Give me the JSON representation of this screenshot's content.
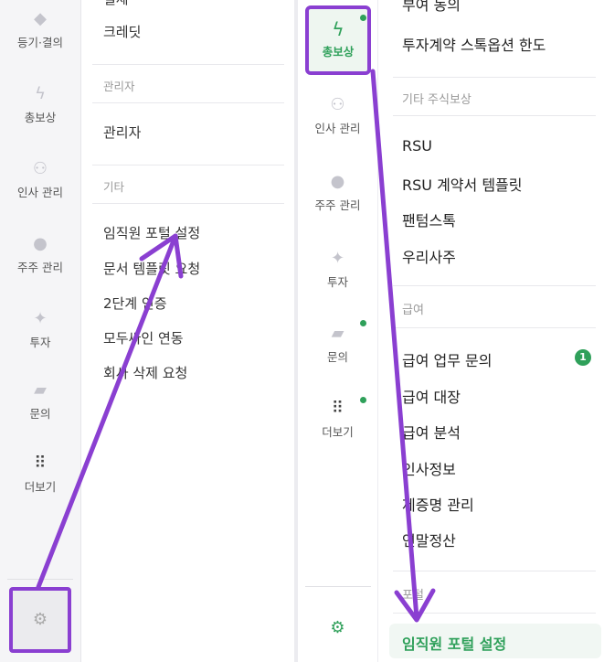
{
  "left_rail": {
    "items": [
      {
        "label": "등기·결의",
        "icon": "layers-icon"
      },
      {
        "label": "총보상",
        "icon": "bolt-icon"
      },
      {
        "label": "인사 관리",
        "icon": "people-icon"
      },
      {
        "label": "주주 관리",
        "icon": "pie-icon"
      },
      {
        "label": "투자",
        "icon": "coin-icon"
      },
      {
        "label": "문의",
        "icon": "chat-icon"
      },
      {
        "label": "더보기",
        "icon": "grid-icon"
      }
    ],
    "settings_icon": "gear-icon"
  },
  "left_menu": {
    "partial_top": "결제",
    "items_top": [
      "크레딧"
    ],
    "section_admin": "관리자",
    "admin_items": [
      "관리자"
    ],
    "section_etc": "기타",
    "etc_items": [
      "임직원 포털 설정",
      "문서 템플릿 요청",
      "2단계 인증",
      "모두싸인 연동",
      "회사 삭제 요청"
    ]
  },
  "right_rail": {
    "active": {
      "label": "총보상",
      "icon": "bolt-icon"
    },
    "items": [
      {
        "label": "인사 관리",
        "icon": "people-icon",
        "dot": false
      },
      {
        "label": "주주 관리",
        "icon": "pie-icon",
        "dot": false
      },
      {
        "label": "투자",
        "icon": "coin-icon",
        "dot": false
      },
      {
        "label": "문의",
        "icon": "chat-icon",
        "dot": true
      },
      {
        "label": "더보기",
        "icon": "grid-icon",
        "dot": true
      }
    ],
    "settings_icon": "gear-icon"
  },
  "right_menu": {
    "partial_top": "부여 동의",
    "items_top": [
      "투자계약 스톡옵션 한도"
    ],
    "section_stock": "기타 주식보상",
    "stock_items": [
      "RSU",
      "RSU 계약서 템플릿",
      "팬텀스톡",
      "우리사주"
    ],
    "section_pay": "급여",
    "pay_items": [
      "급여 업무 문의",
      "급여 대장",
      "급여 분석",
      "인사정보",
      "제증명 관리",
      "연말정산"
    ],
    "pay_badge": "1",
    "section_portal": "포털",
    "portal_item": "임직원 포털 설정"
  },
  "colors": {
    "accent_green": "#2fa05a",
    "highlight_purple": "#8a3fd1"
  }
}
